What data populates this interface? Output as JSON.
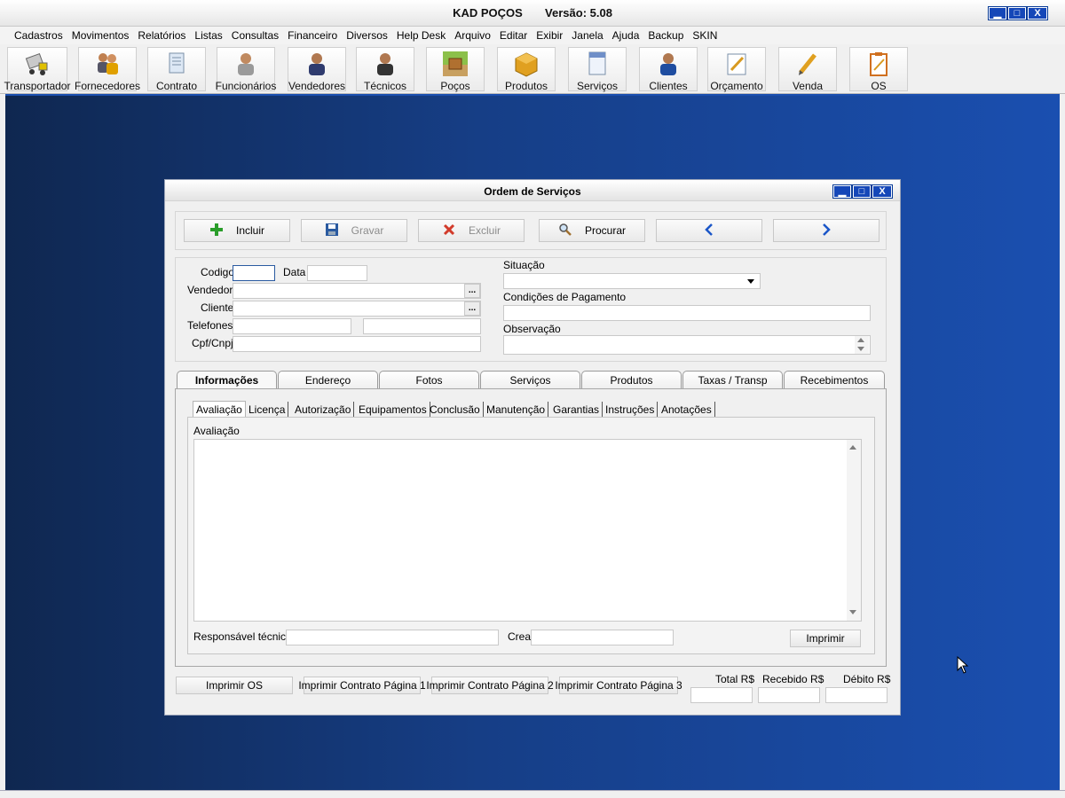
{
  "app": {
    "title": "KAD POÇOS",
    "version": "Versão: 5.08",
    "min_glyph": "▁",
    "max_glyph": "□",
    "close_glyph": "X"
  },
  "menu": [
    "Cadastros",
    "Movimentos",
    "Relatórios",
    "Listas",
    "Consultas",
    "Financeiro",
    "Diversos",
    "Help Desk",
    "Arquivo",
    "Editar",
    "Exibir",
    "Janela",
    "Ajuda",
    "Backup",
    "SKIN"
  ],
  "toolbar": [
    {
      "label": "Transportador",
      "icon": "truck-icon"
    },
    {
      "label": "Fornecedores",
      "icon": "suppliers-icon"
    },
    {
      "label": "Contrato",
      "icon": "contract-icon"
    },
    {
      "label": "Funcionários",
      "icon": "employee-icon"
    },
    {
      "label": "Vendedores",
      "icon": "seller-icon"
    },
    {
      "label": "Técnicos",
      "icon": "technician-icon"
    },
    {
      "label": "Poços",
      "icon": "well-icon"
    },
    {
      "label": "Produtos",
      "icon": "box-icon"
    },
    {
      "label": "Serviços",
      "icon": "document-icon"
    },
    {
      "label": "Clientes",
      "icon": "client-icon"
    },
    {
      "label": "Orçamento",
      "icon": "quote-icon"
    },
    {
      "label": "Venda",
      "icon": "pencil-icon"
    },
    {
      "label": "OS",
      "icon": "clipboard-icon"
    }
  ],
  "dialog": {
    "title": "Ordem de Serviços",
    "actions": {
      "incluir": "Incluir",
      "gravar": "Gravar",
      "excluir": "Excluir",
      "procurar": "Procurar",
      "prev": "‹",
      "next": "›"
    },
    "form": {
      "codigo_label": "Codigo",
      "codigo_value": "",
      "data_label": "Data",
      "data_value": "",
      "vendedor_label": "Vendedor",
      "vendedor_value": "",
      "cliente_label": "Cliente",
      "cliente_value": "",
      "telefones_label": "Telefones",
      "telefone1_value": "",
      "telefone2_value": "",
      "cpf_label": "Cpf/Cnpj",
      "cpf_value": "",
      "situacao_label": "Situação",
      "situacao_value": "",
      "condicoes_label": "Condições de Pagamento",
      "condicoes_value": "",
      "observacao_label": "Observação",
      "observacao_value": "",
      "ellipsis": "..."
    },
    "tabs": [
      "Informações",
      "Endereço",
      "Fotos",
      "Serviços",
      "Produtos",
      "Taxas / Transp",
      "Recebimentos"
    ],
    "active_tab": "Informações",
    "subtabs": [
      "Avaliação",
      "Licença",
      "Autorização",
      "Equipamentos",
      "Conclusão",
      "Manutenção",
      "Garantias",
      "Instruções",
      "Anotações"
    ],
    "active_subtab": "Avaliação",
    "avaliacao_label": "Avaliação",
    "avaliacao_value": "",
    "responsavel_label": "Responsável técnico",
    "responsavel_value": "",
    "crea_label": "Crea",
    "crea_value": "",
    "imprimir": "Imprimir",
    "bottom_buttons": [
      "Imprimir OS",
      "Imprimir Contrato Página 1",
      "Imprimir Contrato Página 2",
      "Imprimir Contrato Página 3"
    ],
    "totals": {
      "total_label": "Total R$",
      "total_value": "",
      "recebido_label": "Recebido R$",
      "recebido_value": "",
      "debito_label": "Débito R$",
      "debito_value": ""
    }
  },
  "colors": {
    "desktop": "#1a4fb0",
    "window_button": "#1547b8",
    "incluir_green": "#2a9d2a",
    "excluir_red": "#d23b2b",
    "nav_blue": "#1a56c8"
  }
}
